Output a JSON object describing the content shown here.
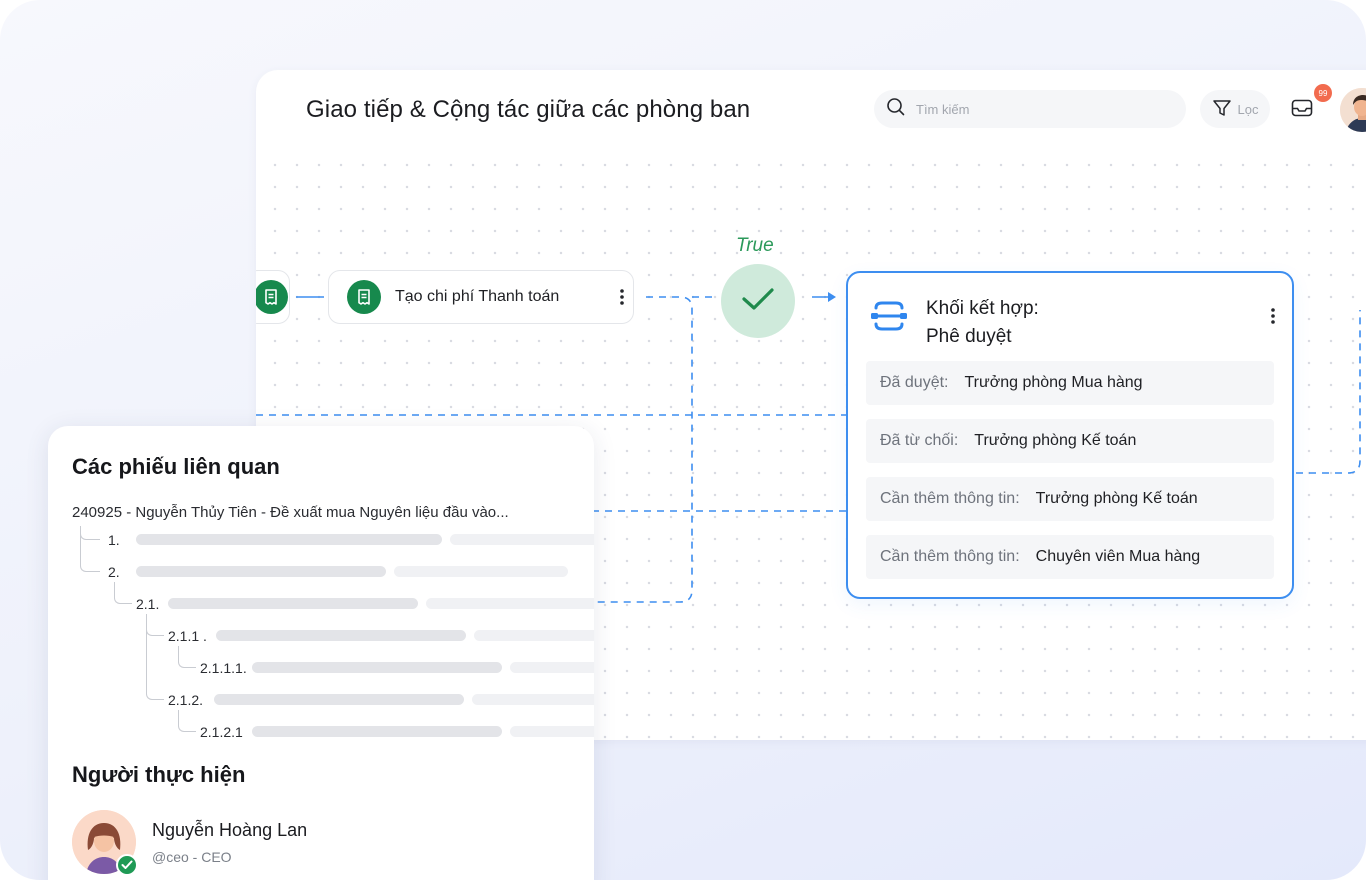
{
  "header": {
    "title": "Giao tiếp & Cộng tác giữa các phòng ban",
    "search_placeholder": "Tìm kiếm",
    "filter_label": "Lọc",
    "inbox_badge": "99"
  },
  "flow": {
    "node_main_label": "Tạo chi phí Thanh toán",
    "condition_label": "True",
    "merge": {
      "title_line1": "Khối kết hợp:",
      "title_line2": "Phê duyệt",
      "rows": [
        {
          "key": "Đã duyệt:",
          "value": "Trưởng phòng Mua hàng"
        },
        {
          "key": "Đã từ chối:",
          "value": "Trưởng phòng Kế toán"
        },
        {
          "key": "Cần thêm thông tin:",
          "value": "Trưởng phòng Kế toán"
        },
        {
          "key": "Cần thêm thông tin:",
          "value": "Chuyên viên Mua hàng"
        }
      ]
    }
  },
  "panel": {
    "related_title": "Các phiếu liên quan",
    "ticket_head": "240925 - Nguyễn Thủy Tiên - Đề xuất mua Nguyên liệu đầu vào...",
    "tree": [
      "1.",
      "2.",
      "2.1.",
      "2.1.1 .",
      "2.1.1.1.",
      "2.1.2.",
      "2.1.2.1"
    ],
    "executor_title": "Người thực hiện",
    "person": {
      "name": "Nguyễn Hoàng Lan",
      "handle": "@ceo - CEO"
    }
  },
  "colors": {
    "accent_blue": "#3d8ef0",
    "green": "#17894d",
    "true_green": "#2c9a5b",
    "badge": "#f26b4e"
  }
}
